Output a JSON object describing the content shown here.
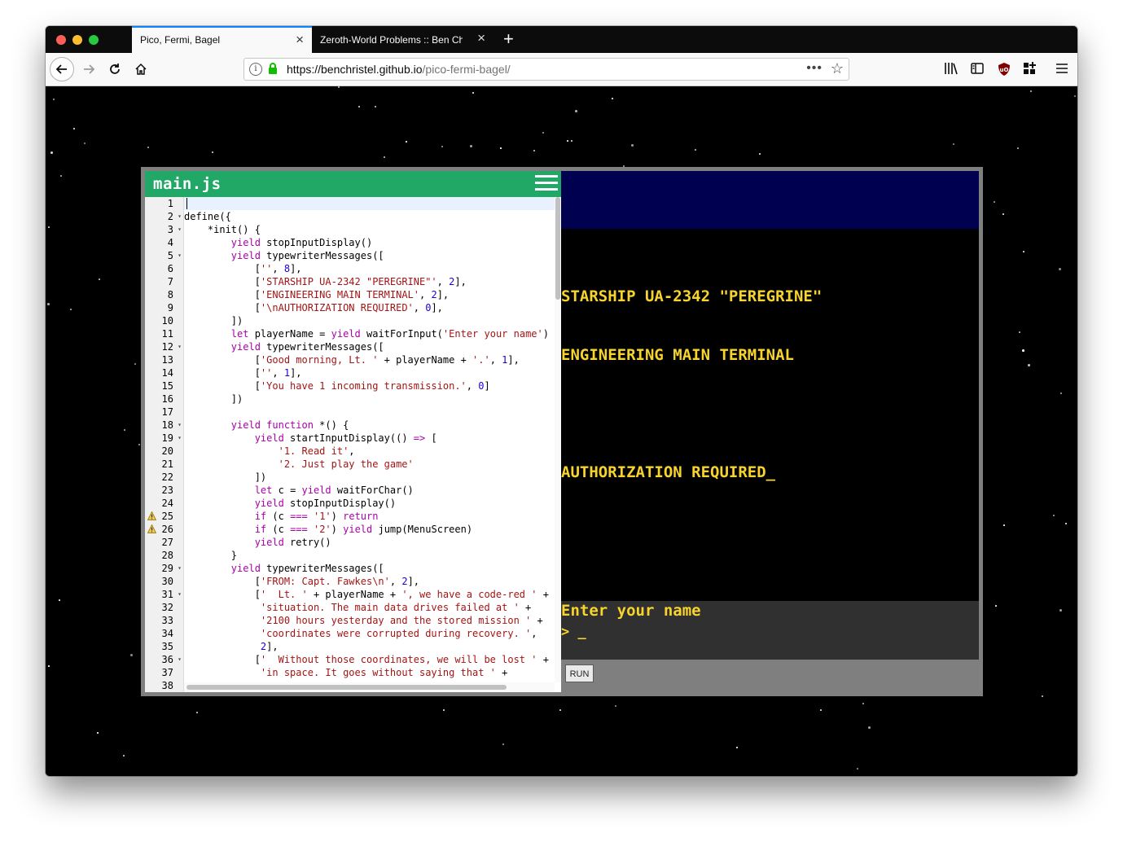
{
  "browser": {
    "tabs": [
      {
        "title": "Pico, Fermi, Bagel"
      },
      {
        "title": "Zeroth-World Problems :: Ben Christel"
      }
    ],
    "url": {
      "origin": "https://benchristel.github.io",
      "path": "/pico-fermi-bagel/"
    },
    "url_menu": "•••"
  },
  "editor": {
    "filename": "main.js",
    "line_numbers": [
      "1",
      "2",
      "3",
      "4",
      "5",
      "6",
      "7",
      "8",
      "9",
      "10",
      "11",
      "12",
      "13",
      "14",
      "15",
      "16",
      "17",
      "18",
      "19",
      "20",
      "21",
      "22",
      "23",
      "24",
      "25",
      "26",
      "27",
      "28",
      "29",
      "30",
      "31",
      "32",
      "33",
      "34",
      "35",
      "36",
      "37",
      "38"
    ]
  },
  "terminal": {
    "output": [
      "STARSHIP UA-2342 \"PEREGRINE\"",
      "ENGINEERING MAIN TERMINAL",
      "",
      "AUTHORIZATION REQUIRED_"
    ],
    "prompt": "Enter your name",
    "input_caret": "> _",
    "run_label": "RUN"
  },
  "colors": {
    "editor_header": "#21a866",
    "terminal_text": "#f6d32d",
    "terminal_banner": "#000050"
  }
}
